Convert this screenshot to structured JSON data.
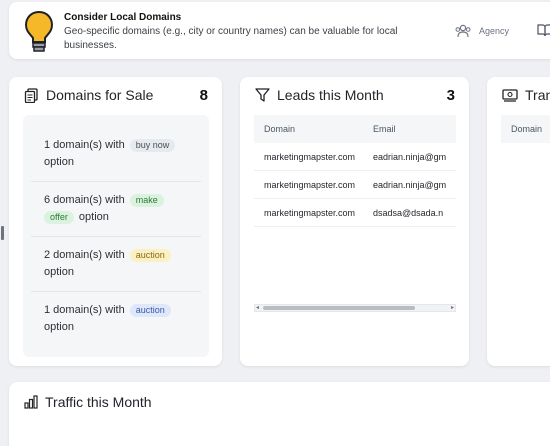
{
  "tip": {
    "title": "Consider Local Domains",
    "text": "Geo-specific domains (e.g., city or country names) can be valuable for local businesses.",
    "link_label": "Agency"
  },
  "domains_for_sale": {
    "title": "Domains for Sale",
    "count": "8",
    "items": [
      {
        "before": "1 domain(s) with",
        "tag": "buy now",
        "after": "option"
      },
      {
        "before": "6 domain(s) with",
        "tag_line1": "make",
        "tag_line2": "offer",
        "after": "option"
      },
      {
        "before": "2 domain(s) with",
        "tag": "auction",
        "after": "option"
      },
      {
        "before": "1 domain(s) with",
        "tag": "auction",
        "after": "option"
      }
    ]
  },
  "leads": {
    "title": "Leads this Month",
    "count": "3",
    "columns": [
      "Domain",
      "Email"
    ],
    "rows": [
      {
        "domain": "marketingmapster.com",
        "email": "eadrian.ninja@gm"
      },
      {
        "domain": "marketingmapster.com",
        "email": "eadrian.ninja@gm"
      },
      {
        "domain": "marketingmapster.com",
        "email": "dsadsa@dsada.n"
      }
    ]
  },
  "transactions": {
    "title": "Trans",
    "columns": [
      "Domain"
    ]
  },
  "traffic": {
    "title": "Traffic this Month"
  },
  "colors": {
    "bulb_fill": "#f5b829",
    "accent": "#1f2328"
  }
}
